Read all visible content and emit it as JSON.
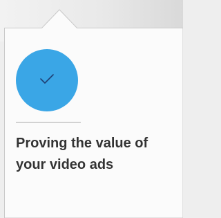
{
  "card": {
    "icon": "checkmark-icon",
    "accent_color": "#3aa6e6",
    "title": "Proving the value of your video ads"
  }
}
